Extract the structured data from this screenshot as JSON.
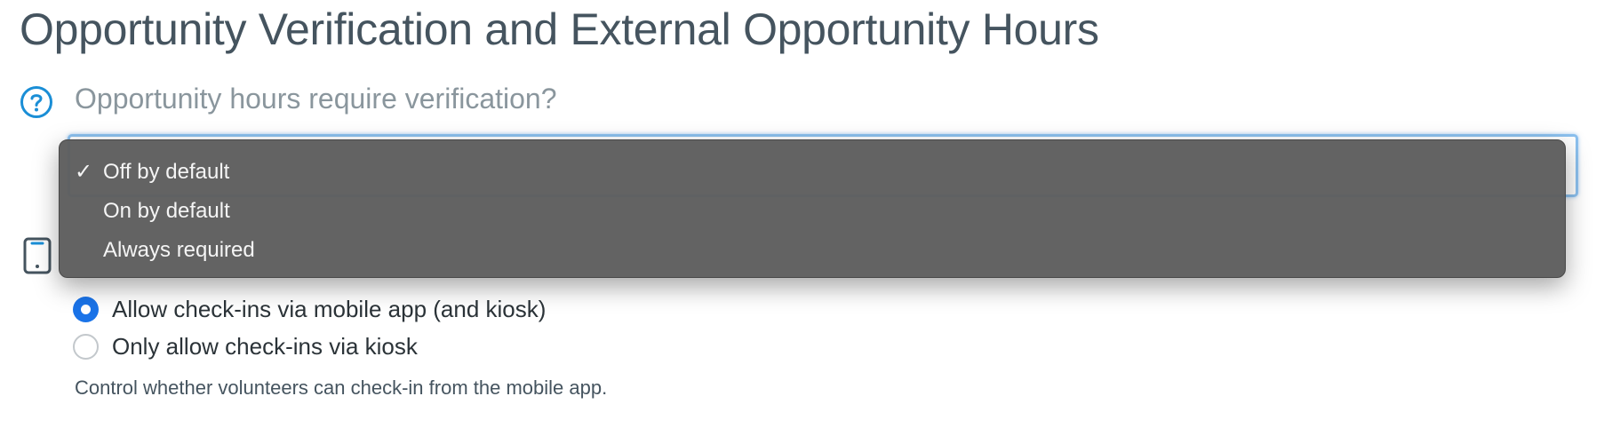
{
  "page": {
    "title": "Opportunity Verification and External Opportunity Hours"
  },
  "verification": {
    "question": "Opportunity hours require verification?",
    "help_icon": "question-circle-icon",
    "dropdown": {
      "selected_index": 0,
      "options": [
        "Off by default",
        "On by default",
        "Always required"
      ]
    }
  },
  "checkin": {
    "icon": "mobile-phone-icon",
    "options": [
      {
        "label": "Allow check-ins via mobile app (and kiosk)",
        "checked": true
      },
      {
        "label": "Only allow check-ins via kiosk",
        "checked": false
      }
    ],
    "help_text": "Control whether volunteers can check-in from the mobile app."
  },
  "colors": {
    "title": "#45545f",
    "accent": "#1a8ed6",
    "radio_checked": "#1a73e8",
    "menu_background": "#5e5e5e"
  }
}
